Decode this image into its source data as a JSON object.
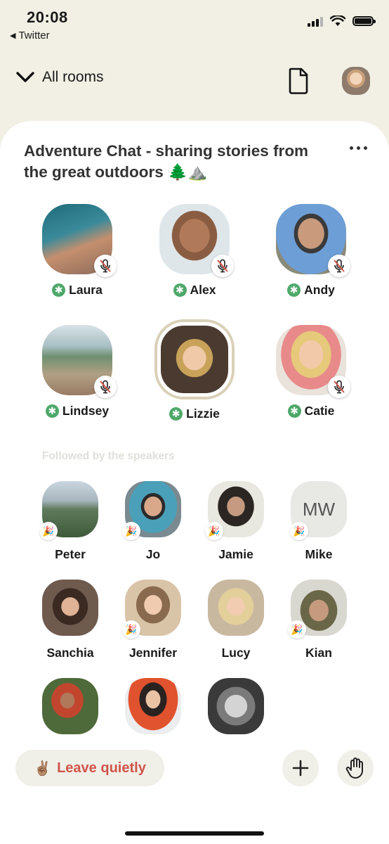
{
  "status_bar": {
    "time": "20:08",
    "back_app": "Twitter"
  },
  "nav": {
    "all_rooms_label": "All rooms"
  },
  "room": {
    "title": "Adventure Chat - sharing stories from the great outdoors 🌲⛰️"
  },
  "speakers": [
    {
      "name": "Laura",
      "muted": true
    },
    {
      "name": "Alex",
      "muted": true
    },
    {
      "name": "Andy",
      "muted": true
    },
    {
      "name": "Lindsey",
      "muted": true
    },
    {
      "name": "Lizzie",
      "muted": false,
      "speaking": true
    },
    {
      "name": "Catie",
      "muted": true
    }
  ],
  "followed_section_label": "Followed by the speakers",
  "listeners": [
    {
      "name": "Peter",
      "badge": "🎉"
    },
    {
      "name": "Jo",
      "badge": "🎉"
    },
    {
      "name": "Jamie",
      "badge": "🎉"
    },
    {
      "name": "Mike",
      "badge": "🎉",
      "initials": "MW"
    },
    {
      "name": "Sanchia"
    },
    {
      "name": "Jennifer",
      "badge": "🎉"
    },
    {
      "name": "Lucy"
    },
    {
      "name": "Kian",
      "badge": "🎉"
    },
    {
      "name": ""
    },
    {
      "name": ""
    },
    {
      "name": ""
    }
  ],
  "bottom_bar": {
    "leave_label": "Leave quietly",
    "leave_emoji": "✌🏽"
  },
  "icons": {
    "moderator_badge": "✱",
    "party_badge": "🎉",
    "back_triangle": "◀"
  },
  "colors": {
    "accent_red": "#d0554a",
    "moderator_green": "#4ea86a",
    "background": "#f2f0e4"
  }
}
